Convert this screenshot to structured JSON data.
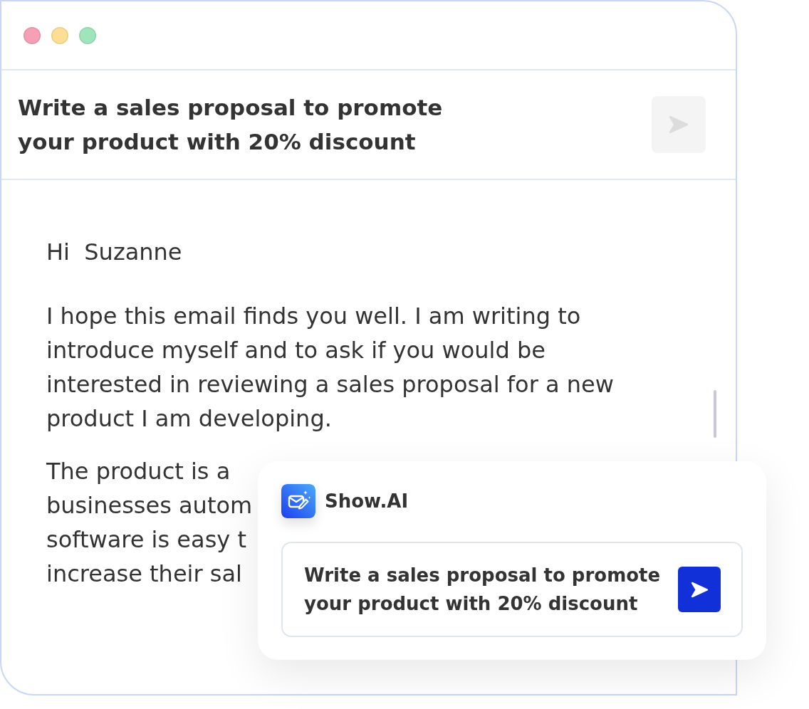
{
  "window": {
    "controls": [
      {
        "color": "#f5a0b4"
      },
      {
        "color": "#fcdf94"
      },
      {
        "color": "#9fe5bb"
      }
    ]
  },
  "prompt_header": {
    "text": "Write a sales proposal to promote your product with 20% discount",
    "send_disabled": true
  },
  "email": {
    "greeting": "Hi  Suzanne",
    "paragraphs": [
      "I hope this email finds you well. I am writing to introduce myself and to ask if you would be interested in reviewing a sales proposal for a new product I am developing."
    ],
    "partly_covered_paragraph_lines": [
      "The product is a",
      "businesses autom",
      "software is easy t",
      "increase their sal"
    ]
  },
  "assistant_card": {
    "name": "Show.AI",
    "prompt": "Write a sales proposal to promote your product with 20% discount",
    "send_disabled": false
  }
}
